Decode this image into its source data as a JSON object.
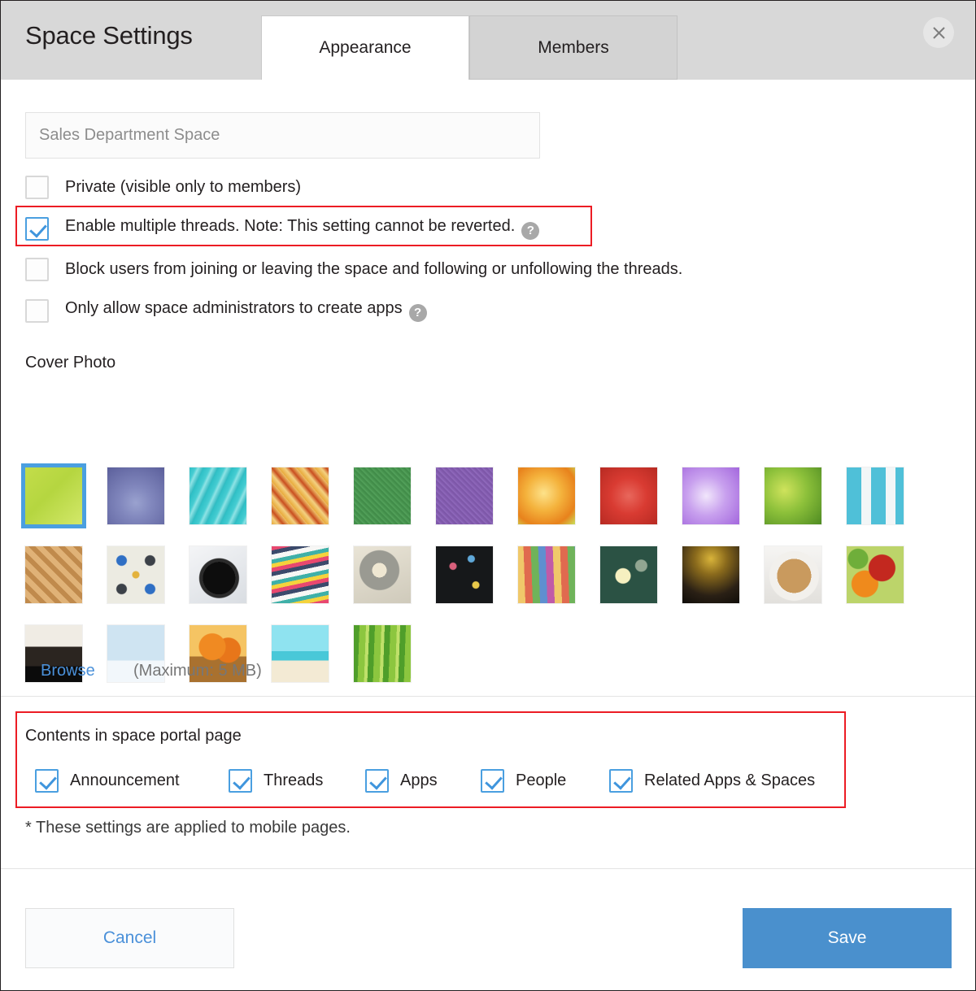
{
  "header": {
    "title": "Space Settings",
    "tabs": [
      {
        "label": "Appearance",
        "active": true
      },
      {
        "label": "Members",
        "active": false
      }
    ],
    "close_icon": "close-icon"
  },
  "form": {
    "space_name_placeholder": "Sales Department Space",
    "space_name_value": "",
    "options": [
      {
        "label": "Private (visible only to members)",
        "checked": false,
        "help": false
      },
      {
        "label": "Enable multiple threads. Note: This setting cannot be reverted.",
        "checked": true,
        "help": true,
        "highlighted": true
      },
      {
        "label": "Block users from joining or leaving the space and following or unfollowing the threads.",
        "checked": false,
        "help": false
      },
      {
        "label": "Only allow space administrators to create apps",
        "checked": false,
        "help": true
      }
    ]
  },
  "cover_photo": {
    "label": "Cover Photo",
    "browse_label": "Browse",
    "max_size_note": "(Maximum: 5 MB)",
    "selected_index": 0,
    "thumbnails": [
      {
        "name": "green-gradient-square",
        "alt": "Green gradient square"
      },
      {
        "name": "blue-purple-gradient",
        "alt": "Blue purple gradient"
      },
      {
        "name": "turquoise-water",
        "alt": "Turquoise water"
      },
      {
        "name": "orange-grunge-texture",
        "alt": "Orange grunge texture"
      },
      {
        "name": "green-felt-texture",
        "alt": "Green felt texture"
      },
      {
        "name": "purple-felt-texture",
        "alt": "Purple felt texture"
      },
      {
        "name": "orange-lily-flower",
        "alt": "Orange lily flower"
      },
      {
        "name": "red-carnation-flower",
        "alt": "Red carnation flower"
      },
      {
        "name": "purple-hyacinth-flower",
        "alt": "Purple hyacinth flower"
      },
      {
        "name": "green-leaf-dew",
        "alt": "Green leaf with dew"
      },
      {
        "name": "white-cubes-blue",
        "alt": "White cubes on blue"
      },
      {
        "name": "woven-bamboo-mat",
        "alt": "Woven bamboo mat"
      },
      {
        "name": "moroccan-tile-pattern",
        "alt": "Moroccan tile pattern"
      },
      {
        "name": "compass-on-map",
        "alt": "Compass on map"
      },
      {
        "name": "stacked-books",
        "alt": "Stacked colorful books"
      },
      {
        "name": "gear-on-blueprint",
        "alt": "Gear on blueprint"
      },
      {
        "name": "chalkboard-doodles",
        "alt": "Chalkboard doodles"
      },
      {
        "name": "colored-pencils-faces",
        "alt": "Colored pencils with faces"
      },
      {
        "name": "lightbulb-chalkboard",
        "alt": "Lightbulb drawn on chalkboard"
      },
      {
        "name": "dark-gold-gradient",
        "alt": "Dark gold gradient"
      },
      {
        "name": "latte-art-coffee",
        "alt": "Latte art coffee cup"
      },
      {
        "name": "fresh-vegetables",
        "alt": "Fresh vegetables"
      },
      {
        "name": "cat-and-dog",
        "alt": "Cat and dog"
      },
      {
        "name": "winter-frost-trees",
        "alt": "Winter frosted trees"
      },
      {
        "name": "pumpkin-basket",
        "alt": "Basket of pumpkins"
      },
      {
        "name": "tropical-beach-palm",
        "alt": "Tropical beach with palm"
      },
      {
        "name": "green-bamboo-stalks",
        "alt": "Green bamboo stalks"
      }
    ]
  },
  "portal": {
    "title": "Contents in space portal page",
    "items": [
      {
        "label": "Announcement",
        "checked": true
      },
      {
        "label": "Threads",
        "checked": true
      },
      {
        "label": "Apps",
        "checked": true
      },
      {
        "label": "People",
        "checked": true
      },
      {
        "label": "Related Apps & Spaces",
        "checked": true
      }
    ]
  },
  "notes": {
    "mobile": "* These settings are applied to mobile pages."
  },
  "footer": {
    "cancel_label": "Cancel",
    "save_label": "Save"
  },
  "colors": {
    "accent_blue": "#4a90d9",
    "save_blue": "#4a90cd",
    "highlight_red": "#ec1c24",
    "header_gray": "#d8d8d8"
  }
}
